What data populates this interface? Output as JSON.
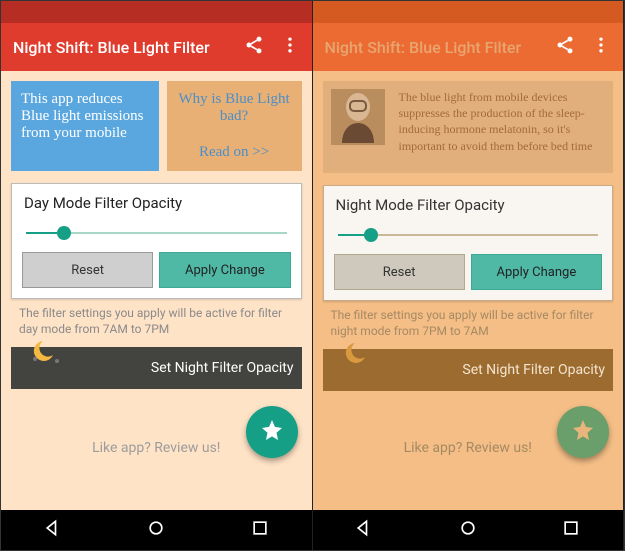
{
  "left": {
    "appbar": {
      "title": "Night Shift: Blue Light Filter"
    },
    "info": {
      "cardA": "This app reduces Blue light emissions from your mobile",
      "cardB_q": "Why is Blue Light bad?",
      "cardB_link": "Read on >>"
    },
    "panel": {
      "title": "Day Mode Filter Opacity",
      "reset": "Reset",
      "apply": "Apply Change",
      "slider_pct": 12
    },
    "note": "The filter settings you apply will be active for filter day mode from 7AM to 7PM",
    "nightbar": "Set Night Filter Opacity",
    "review": "Like app? Review us!"
  },
  "right": {
    "appbar": {
      "title": "Night Shift: Blue Light Filter"
    },
    "info": {
      "desc": "The blue light from mobile devices suppresses the production of the sleep-inducing hormone melatonin, so it's important to avoid them before bed time"
    },
    "panel": {
      "title": "Night Mode Filter Opacity",
      "reset": "Reset",
      "apply": "Apply Change",
      "slider_pct": 10
    },
    "note": "The filter settings you apply will be active for filter night mode from 7PM to 7AM",
    "nightbar": "Set Night Filter Opacity",
    "review": "Like app? Review us!"
  }
}
